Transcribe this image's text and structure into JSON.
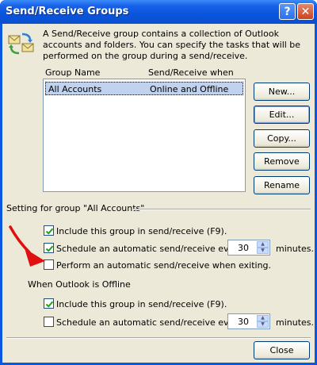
{
  "window": {
    "title": "Send/Receive Groups",
    "help_glyph": "?",
    "close_glyph": "✕"
  },
  "description": "A Send/Receive group contains a collection of Outlook accounts and folders. You can specify the tasks that will be performed on the group during a send/receive.",
  "groups_list": {
    "col_group_name": "Group Name",
    "col_send_receive_when": "Send/Receive when",
    "rows": [
      {
        "name": "All Accounts",
        "when": "Online and Offline",
        "selected": true
      }
    ]
  },
  "buttons": {
    "new": "New...",
    "edit": "Edit...",
    "copy": "Copy...",
    "remove": "Remove",
    "rename": "Rename",
    "close": "Close"
  },
  "settings": {
    "label": "Setting for group \"All Accounts\"",
    "online": {
      "include_label": "Include this group in send/receive (F9).",
      "include_checked": true,
      "schedule_label": "Schedule an automatic send/receive every",
      "schedule_checked": true,
      "schedule_minutes": "30",
      "minutes_label": "minutes.",
      "exit_label": "Perform an automatic send/receive when exiting.",
      "exit_checked": false
    },
    "offline": {
      "header": "When Outlook is Offline",
      "include_label": "Include this group in send/receive (F9).",
      "include_checked": true,
      "schedule_label": "Schedule an automatic send/receive every",
      "schedule_checked": false,
      "schedule_minutes": "30",
      "minutes_label": "minutes."
    }
  },
  "colors": {
    "title_bar": "#0a55dc",
    "dialog_bg": "#ece9d8",
    "selection": "#c1d2ee",
    "annotation_arrow": "#e01010"
  }
}
